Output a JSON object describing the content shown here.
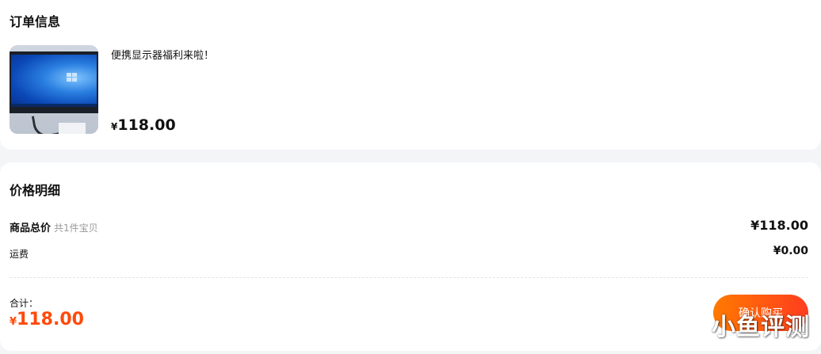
{
  "order": {
    "title": "订单信息",
    "product": {
      "name": "便携显示器福利来啦！",
      "currency": "¥",
      "price": "118.00",
      "image_icon": "monitor-image"
    }
  },
  "price_detail": {
    "title": "价格明细",
    "goods_total_label": "商品总价",
    "goods_count": "共1件宝贝",
    "goods_total_currency": "¥",
    "goods_total_value": "118.00",
    "shipping_label": "运费",
    "shipping_currency": "¥",
    "shipping_value": "0.00",
    "sum_label": "合计：",
    "sum_currency": "¥",
    "sum_value": "118.00",
    "confirm_button": "确认购买"
  },
  "watermark": "小鱼评测",
  "colors": {
    "accent": "#ff4a0a",
    "button_start": "#ff7a00",
    "button_end": "#ff3d1f",
    "background": "#f4f5f7"
  }
}
